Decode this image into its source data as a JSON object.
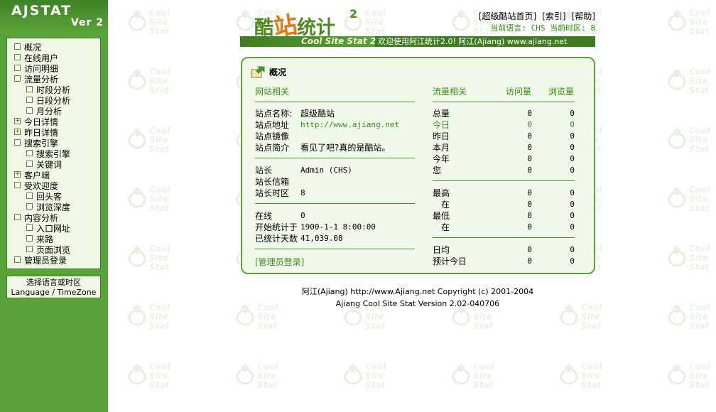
{
  "sidebar": {
    "logo_title": "AJSTAT",
    "logo_version": "Ver 2",
    "menu": [
      {
        "label": "概况",
        "mark": ""
      },
      {
        "label": "在线用户",
        "mark": ""
      },
      {
        "label": "访问明细",
        "mark": ""
      },
      {
        "label": "流量分析",
        "mark": ""
      },
      {
        "label": "时段分析",
        "mark": ""
      },
      {
        "label": "日段分析",
        "mark": ""
      },
      {
        "label": "月分析",
        "mark": ""
      },
      {
        "label": "今日详情",
        "mark": "+"
      },
      {
        "label": "昨日详情",
        "mark": "+"
      },
      {
        "label": "搜索引擎",
        "mark": ""
      },
      {
        "label": "搜索引擎",
        "mark": ""
      },
      {
        "label": "关键词",
        "mark": ""
      },
      {
        "label": "客户端",
        "mark": "+"
      },
      {
        "label": "受欢迎度",
        "mark": ""
      },
      {
        "label": "回头客",
        "mark": ""
      },
      {
        "label": "浏览深度",
        "mark": ""
      },
      {
        "label": "内容分析",
        "mark": ""
      },
      {
        "label": "入口网址",
        "mark": ""
      },
      {
        "label": "来路",
        "mark": ""
      },
      {
        "label": "页面浏览",
        "mark": ""
      },
      {
        "label": "管理员登录",
        "mark": ""
      }
    ],
    "lang_cn": "选择语言或时区",
    "lang_en": "Language / TimeZone"
  },
  "header": {
    "logo_pre": "酷",
    "logo_mid": "站",
    "logo_post": "统计",
    "logo_sup": "2",
    "links": [
      "[超级酷站首页]",
      "[索引]",
      "[帮助]"
    ],
    "lang_line": "当前语言: CHS  当前时区: 8",
    "banner_en": "Cool Site Stat 2",
    "banner_msg": "欢迎使用阿江统计2.0!  阿江(Ajiang) www.ajiang.net"
  },
  "watermark": "Cool Site Stat",
  "card": {
    "title": "概况",
    "left_head": "网站相关",
    "right_head": "流量相关",
    "col_visits": "访问量",
    "col_views": "浏览量",
    "site_name_label": "站点名称:",
    "site_name": "超级酷站",
    "site_url_label": "站点地址",
    "site_url": "http://www.ajiang.net",
    "site_mirror_label": "站点镜像",
    "site_desc_label": "站点简介",
    "site_desc": "看见了吧?真的是酷站。",
    "owner_label": "站长",
    "owner": "Admin (CHS)",
    "owner_mail_label": "站长信箱",
    "owner_tz_label": "站长时区",
    "owner_tz": "8",
    "online_label": "在线",
    "online": "0",
    "start_label": "开始统计于",
    "start": "1900-1-1 8:00:00",
    "days_label": "已统计天数",
    "days": "41,039.08",
    "admin_login": "[管理员登录]",
    "stats": [
      {
        "label": "总量",
        "visits": "0",
        "views": "0"
      },
      {
        "label": "今日",
        "visits": "0",
        "views": "0"
      },
      {
        "label": "昨日",
        "visits": "0",
        "views": "0"
      },
      {
        "label": "本月",
        "visits": "0",
        "views": "0"
      },
      {
        "label": "今年",
        "visits": "0",
        "views": "0"
      },
      {
        "label": "您",
        "visits": "0",
        "views": "0"
      },
      {
        "label": "最高",
        "visits": "0",
        "views": "0"
      },
      {
        "label": "在",
        "visits": "0",
        "views": "0"
      },
      {
        "label": "最低",
        "visits": "0",
        "views": "0"
      },
      {
        "label": "在",
        "visits": "0",
        "views": "0"
      },
      {
        "label": "日均",
        "visits": "0",
        "views": "0"
      },
      {
        "label": "预计今日",
        "visits": "0",
        "views": "0"
      }
    ]
  },
  "footer": {
    "line1": "阿江(Ajiang) http://www.Ajiang.net Copyright (c) 2001-2004",
    "line2": "Ajiang Cool Site Stat  Version 2.02-040706"
  }
}
